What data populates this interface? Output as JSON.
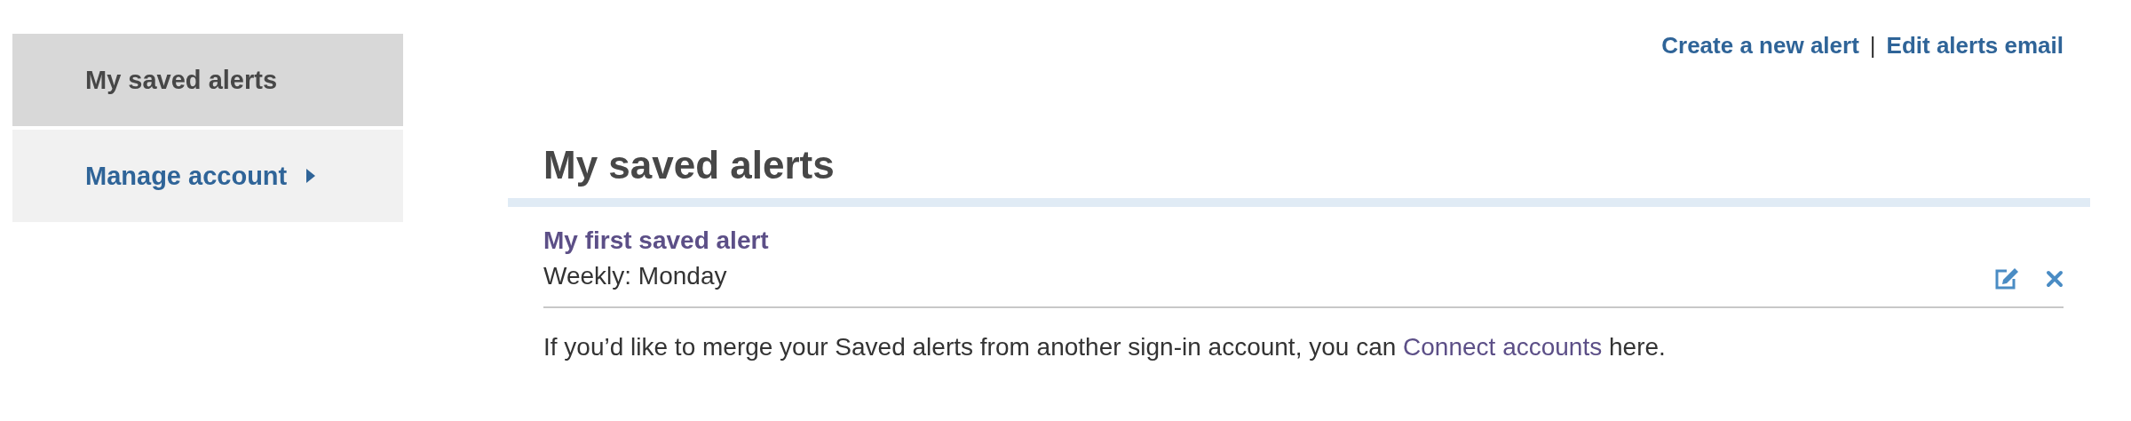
{
  "sidebar": {
    "items": [
      {
        "label": "My saved alerts",
        "selected": true,
        "has_caret": false
      },
      {
        "label": "Manage account",
        "selected": false,
        "has_caret": true
      }
    ]
  },
  "top_links": [
    "Create a new alert",
    "|",
    "Edit alerts email"
  ],
  "heading": "My saved alerts",
  "alerts": [
    {
      "title": "My first saved alert",
      "schedule": "Weekly: Monday"
    }
  ],
  "note": {
    "before": "If you’d like to merge your Saved alerts from another sign-in account, you can ",
    "link": "Connect accounts",
    "after": " here."
  }
}
